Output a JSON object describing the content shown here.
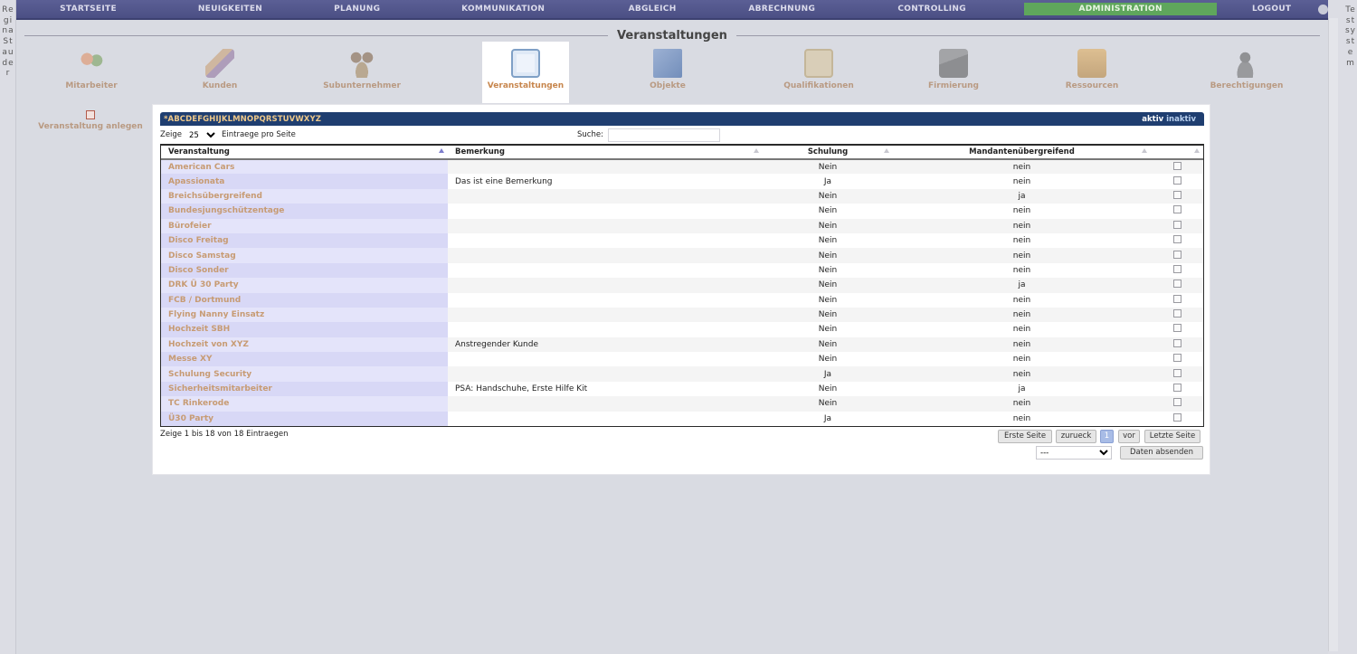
{
  "left_sidebar": {
    "text": "Regina Stauder"
  },
  "right_sidebar": {
    "text": "Testsystem"
  },
  "topnav": {
    "items": [
      {
        "label": "STARTSEITE"
      },
      {
        "label": "NEUIGKEITEN"
      },
      {
        "label": "PLANUNG"
      },
      {
        "label": "KOMMUNIKATION"
      },
      {
        "label": "ABGLEICH"
      },
      {
        "label": "ABRECHNUNG"
      },
      {
        "label": "CONTROLLING"
      },
      {
        "label": "ADMINISTRATION",
        "active": true
      },
      {
        "label": "LOGOUT"
      }
    ],
    "active_color": "#5fa65c",
    "bar_color": "#4f5388"
  },
  "page": {
    "title": "Veranstaltungen"
  },
  "iconbar": {
    "items": [
      {
        "label": "Mitarbeiter",
        "icon": "people-icon"
      },
      {
        "label": "Kunden",
        "icon": "handshake-icon"
      },
      {
        "label": "Subunternehmer",
        "icon": "partners-icon"
      },
      {
        "label": "Veranstaltungen",
        "icon": "event-board-icon",
        "active": true
      },
      {
        "label": "Objekte",
        "icon": "cube-icon"
      },
      {
        "label": "Qualifikationen",
        "icon": "certificate-icon"
      },
      {
        "label": "Firmierung",
        "icon": "telephone-icon"
      },
      {
        "label": "Ressourcen",
        "icon": "boxes-icon"
      },
      {
        "label": "Berechtigungen",
        "icon": "user-key-icon"
      }
    ]
  },
  "side_action": {
    "label": "Veranstaltung anlegen",
    "icon": "calendar-icon"
  },
  "table_header": {
    "alphabet": "*ABCDEFGHIJKLMNOPQRSTUVWXYZ",
    "filter_active": "aktiv",
    "filter_inactive": "inaktiv"
  },
  "controls": {
    "show_label": "Zeige",
    "page_size": "25",
    "entries_label": "Eintraege pro Seite",
    "search_label": "Suche:",
    "search_value": ""
  },
  "columns": [
    "Veranstaltung",
    "Bemerkung",
    "Schulung",
    "Mandantenübergreifend",
    ""
  ],
  "rows": [
    {
      "name": "American Cars",
      "bemerkung": "",
      "schulung": "Nein",
      "mandant": "nein"
    },
    {
      "name": "Apassionata",
      "bemerkung": "Das ist eine Bemerkung",
      "schulung": "Ja",
      "mandant": "nein"
    },
    {
      "name": "Breichsübergreifend",
      "bemerkung": "",
      "schulung": "Nein",
      "mandant": "ja"
    },
    {
      "name": "Bundesjungschützentage",
      "bemerkung": "",
      "schulung": "Nein",
      "mandant": "nein"
    },
    {
      "name": "Bürofeier",
      "bemerkung": "",
      "schulung": "Nein",
      "mandant": "nein"
    },
    {
      "name": "Disco Freitag",
      "bemerkung": "",
      "schulung": "Nein",
      "mandant": "nein"
    },
    {
      "name": "Disco Samstag",
      "bemerkung": "",
      "schulung": "Nein",
      "mandant": "nein"
    },
    {
      "name": "Disco Sonder",
      "bemerkung": "",
      "schulung": "Nein",
      "mandant": "nein"
    },
    {
      "name": "DRK Ü 30 Party",
      "bemerkung": "",
      "schulung": "Nein",
      "mandant": "ja"
    },
    {
      "name": "FCB / Dortmund",
      "bemerkung": "",
      "schulung": "Nein",
      "mandant": "nein"
    },
    {
      "name": "Flying Nanny Einsatz",
      "bemerkung": "",
      "schulung": "Nein",
      "mandant": "nein"
    },
    {
      "name": "Hochzeit SBH",
      "bemerkung": "",
      "schulung": "Nein",
      "mandant": "nein"
    },
    {
      "name": "Hochzeit von XYZ",
      "bemerkung": "Anstregender Kunde",
      "schulung": "Nein",
      "mandant": "nein"
    },
    {
      "name": "Messe XY",
      "bemerkung": "",
      "schulung": "Nein",
      "mandant": "nein"
    },
    {
      "name": "Schulung Security",
      "bemerkung": "",
      "schulung": "Ja",
      "mandant": "nein"
    },
    {
      "name": "Sicherheitsmitarbeiter",
      "bemerkung": "PSA: Handschuhe, Erste Hilfe Kit",
      "schulung": "Nein",
      "mandant": "ja"
    },
    {
      "name": "TC Rinkerode",
      "bemerkung": "",
      "schulung": "Nein",
      "mandant": "nein"
    },
    {
      "name": "Ü30 Party",
      "bemerkung": "",
      "schulung": "Ja",
      "mandant": "nein"
    }
  ],
  "footer": {
    "info": "Zeige 1 bis 18 von 18 Eintraegen",
    "first": "Erste Seite",
    "prev": "zurueck",
    "page": "1",
    "next": "vor",
    "last": "Letzte Seite",
    "action_select": "---",
    "submit": "Daten absenden"
  }
}
